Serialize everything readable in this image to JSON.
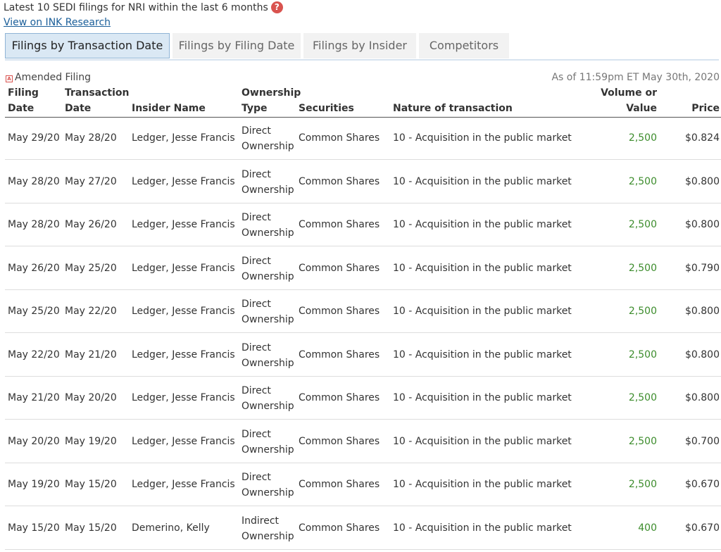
{
  "header": {
    "title": "Latest 10 SEDI filings for NRI within the last 6 months",
    "help_icon": "question-circle-icon",
    "link_label": "View on INK Research"
  },
  "tabs": [
    {
      "label": "Filings by Transaction Date",
      "active": true
    },
    {
      "label": "Filings by Filing Date",
      "active": false
    },
    {
      "label": "Filings by Insider",
      "active": false
    },
    {
      "label": "Competitors",
      "active": false
    }
  ],
  "legend": {
    "amended_label": "Amended Filing",
    "amended_icon": "amended-flag-icon"
  },
  "as_of": "As of 11:59pm ET May 30th, 2020",
  "columns": {
    "filing_date": [
      "Filing",
      "Date"
    ],
    "transaction_date": [
      "Transaction",
      "Date"
    ],
    "insider_name": "Insider Name",
    "ownership_type": [
      "Ownership",
      "Type"
    ],
    "securities": "Securities",
    "nature": "Nature of transaction",
    "volume": [
      "Volume or",
      "Value"
    ],
    "price": "Price"
  },
  "colors": {
    "volume_positive": "#3c8c2c",
    "active_tab": "#dae8f4",
    "alert": "#d9534f"
  },
  "rows": [
    {
      "filing_date": "May 29/20",
      "transaction_date": "May 28/20",
      "insider": "Ledger, Jesse Francis",
      "ownership": [
        "Direct",
        "Ownership"
      ],
      "securities": "Common Shares",
      "nature": "10 - Acquisition in the public market",
      "volume": "2,500",
      "price": "$0.824"
    },
    {
      "filing_date": "May 28/20",
      "transaction_date": "May 27/20",
      "insider": "Ledger, Jesse Francis",
      "ownership": [
        "Direct",
        "Ownership"
      ],
      "securities": "Common Shares",
      "nature": "10 - Acquisition in the public market",
      "volume": "2,500",
      "price": "$0.800"
    },
    {
      "filing_date": "May 28/20",
      "transaction_date": "May 26/20",
      "insider": "Ledger, Jesse Francis",
      "ownership": [
        "Direct",
        "Ownership"
      ],
      "securities": "Common Shares",
      "nature": "10 - Acquisition in the public market",
      "volume": "2,500",
      "price": "$0.800"
    },
    {
      "filing_date": "May 26/20",
      "transaction_date": "May 25/20",
      "insider": "Ledger, Jesse Francis",
      "ownership": [
        "Direct",
        "Ownership"
      ],
      "securities": "Common Shares",
      "nature": "10 - Acquisition in the public market",
      "volume": "2,500",
      "price": "$0.790"
    },
    {
      "filing_date": "May 25/20",
      "transaction_date": "May 22/20",
      "insider": "Ledger, Jesse Francis",
      "ownership": [
        "Direct",
        "Ownership"
      ],
      "securities": "Common Shares",
      "nature": "10 - Acquisition in the public market",
      "volume": "2,500",
      "price": "$0.800"
    },
    {
      "filing_date": "May 22/20",
      "transaction_date": "May 21/20",
      "insider": "Ledger, Jesse Francis",
      "ownership": [
        "Direct",
        "Ownership"
      ],
      "securities": "Common Shares",
      "nature": "10 - Acquisition in the public market",
      "volume": "2,500",
      "price": "$0.800"
    },
    {
      "filing_date": "May 21/20",
      "transaction_date": "May 20/20",
      "insider": "Ledger, Jesse Francis",
      "ownership": [
        "Direct",
        "Ownership"
      ],
      "securities": "Common Shares",
      "nature": "10 - Acquisition in the public market",
      "volume": "2,500",
      "price": "$0.800"
    },
    {
      "filing_date": "May 20/20",
      "transaction_date": "May 19/20",
      "insider": "Ledger, Jesse Francis",
      "ownership": [
        "Direct",
        "Ownership"
      ],
      "securities": "Common Shares",
      "nature": "10 - Acquisition in the public market",
      "volume": "2,500",
      "price": "$0.700"
    },
    {
      "filing_date": "May 19/20",
      "transaction_date": "May 15/20",
      "insider": "Ledger, Jesse Francis",
      "ownership": [
        "Direct",
        "Ownership"
      ],
      "securities": "Common Shares",
      "nature": "10 - Acquisition in the public market",
      "volume": "2,500",
      "price": "$0.670"
    },
    {
      "filing_date": "May 15/20",
      "transaction_date": "May 15/20",
      "insider": "Demerino, Kelly",
      "ownership": [
        "Indirect",
        "Ownership"
      ],
      "securities": "Common Shares",
      "nature": "10 - Acquisition in the public market",
      "volume": "400",
      "price": "$0.670"
    }
  ]
}
